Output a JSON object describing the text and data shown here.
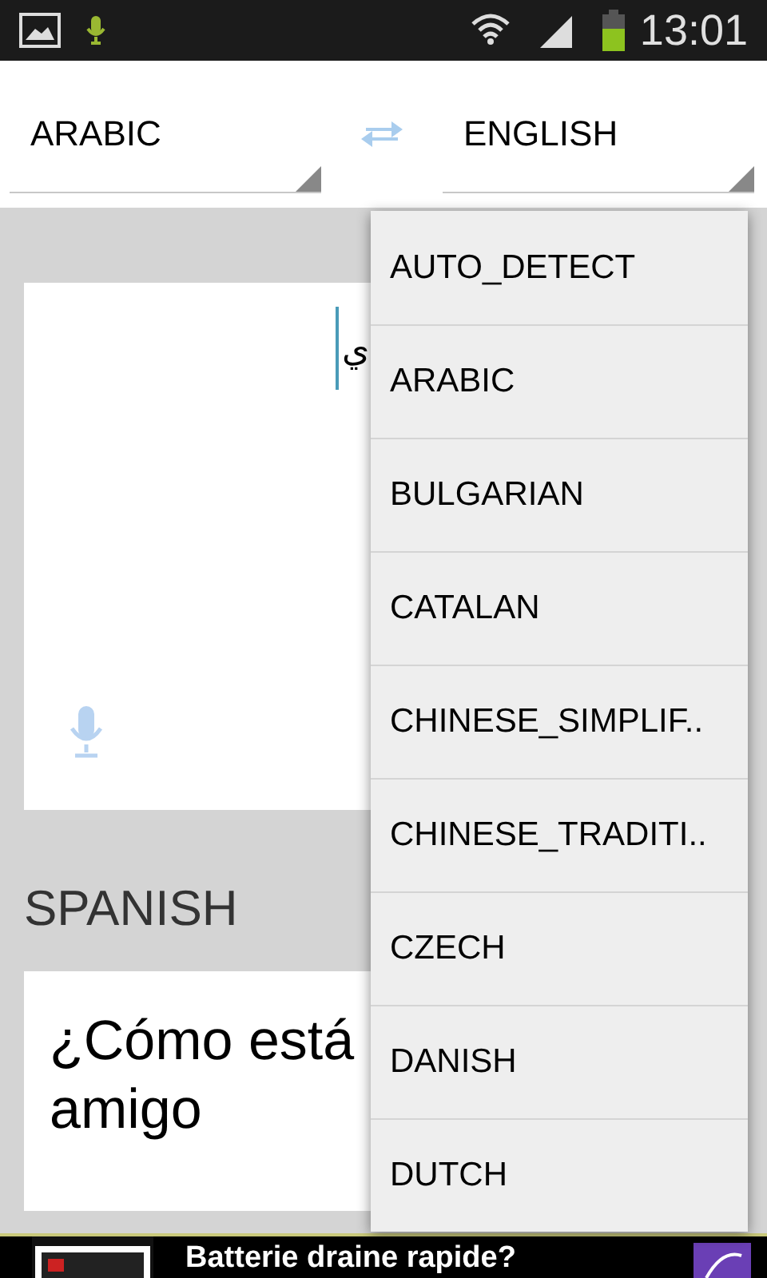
{
  "status_bar": {
    "time": "13:01"
  },
  "source_language": "ARABIC",
  "target_language": "ENGLISH",
  "input": {
    "value": "ي"
  },
  "output_language": "SPANISH",
  "output_lines": [
    "¿Cómo está",
    "amigo"
  ],
  "language_menu": [
    "AUTO_DETECT",
    "ARABIC",
    "BULGARIAN",
    "CATALAN",
    "CHINESE_SIMPLIF..",
    "CHINESE_TRADITI..",
    "CZECH",
    "DANISH",
    "DUTCH"
  ],
  "ad": {
    "text": "Batterie draine rapide?"
  }
}
